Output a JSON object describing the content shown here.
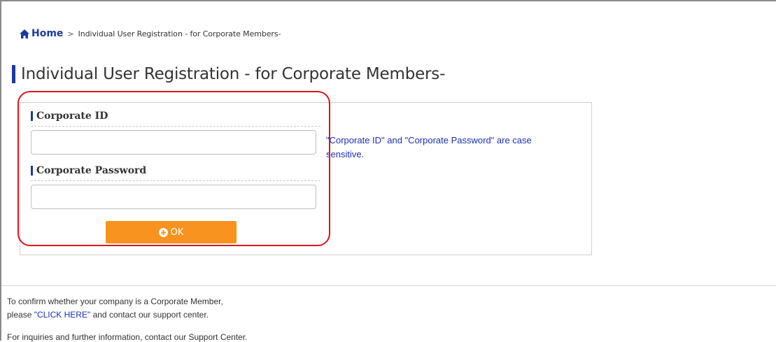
{
  "breadcrumb": {
    "home": "Home",
    "separator": ">",
    "current": "Individual User Registration - for Corporate Members-"
  },
  "page": {
    "title": "Individual User Registration - for Corporate Members-"
  },
  "form": {
    "corporate_id_label": "Corporate ID",
    "corporate_id_value": "",
    "corporate_password_label": "Corporate Password",
    "corporate_password_value": "",
    "ok_label": "OK",
    "note": "\"Corporate ID\" and \"Corporate Password\" are case sensitive."
  },
  "footer": {
    "line1": "To confirm whether your company is a Corporate Member,",
    "line2_pre": "please ",
    "click_here": "\"CLICK HERE\"",
    "line2_post": " and contact our support center.",
    "line3": "For inquiries and further information, contact our Support Center."
  },
  "icons": {
    "home": "home-icon",
    "ok": "plus-circle-icon"
  },
  "colors": {
    "brand_blue": "#1b3a9e",
    "link_blue": "#1b2fb5",
    "button_orange": "#f7931e",
    "highlight_red": "#d9141f"
  }
}
